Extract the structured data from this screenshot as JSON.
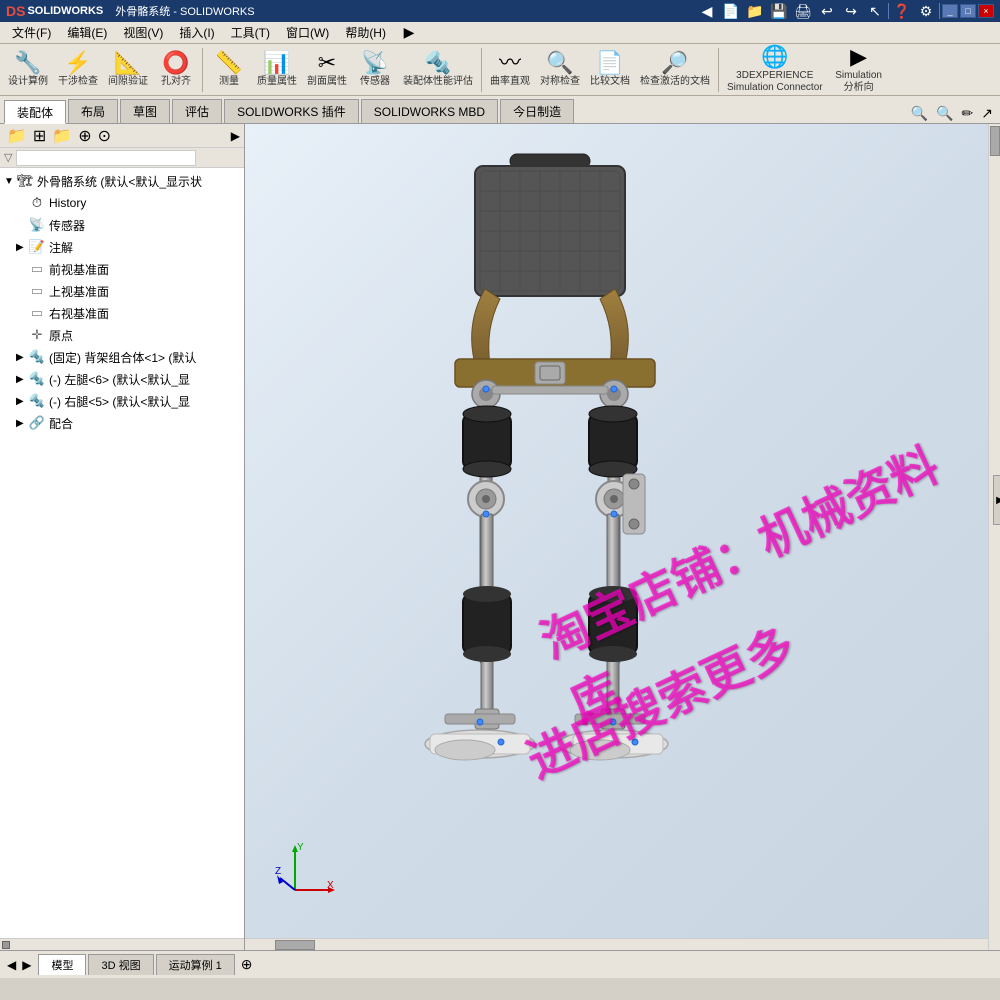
{
  "app": {
    "name": "SOLIDWORKS",
    "logo": "DS",
    "title": "外骨骼系统 - SOLIDWORKS"
  },
  "menubar": {
    "items": [
      "文件(F)",
      "编辑(E)",
      "视图(V)",
      "插入(I)",
      "工具(T)",
      "窗口(W)",
      "帮助(H)"
    ]
  },
  "toolbar": {
    "groups": [
      {
        "icon": "🔧",
        "label": "设计算例"
      },
      {
        "icon": "⚡",
        "label": "干涉检查"
      },
      {
        "icon": "📐",
        "label": "间隙验证"
      },
      {
        "icon": "⭕",
        "label": "孔对齐"
      },
      {
        "icon": "📏",
        "label": "测量"
      },
      {
        "icon": "📊",
        "label": "质量属性"
      },
      {
        "icon": "✂",
        "label": "剖面属性"
      },
      {
        "icon": "📡",
        "label": "传感器"
      },
      {
        "icon": "🔩",
        "label": "装配体性能评估"
      },
      {
        "icon": "〰",
        "label": "曲率直观"
      },
      {
        "icon": "🔍",
        "label": "对称检查"
      },
      {
        "icon": "📄",
        "label": "比较文档"
      },
      {
        "icon": "🔎",
        "label": "检查激活的文档"
      }
    ],
    "right_groups": [
      {
        "icon": "🌐",
        "label": "3DEXPERIENCE\nSimulation Connector"
      },
      {
        "icon": "▶",
        "label": "Simulation\n分析向"
      }
    ]
  },
  "tabs": {
    "items": [
      "装配体",
      "布局",
      "草图",
      "评估",
      "SOLIDWORKS 插件",
      "SOLIDWORKS MBD",
      "今日制造"
    ],
    "active": 0
  },
  "subtoolbar": {
    "icons": [
      "🔍",
      "🔍",
      "✏",
      "↗"
    ]
  },
  "feature_tree": {
    "root_label": "外骨骼系统 (默认<默认_显示状",
    "items": [
      {
        "level": 1,
        "icon": "⏱",
        "label": "History",
        "has_arrow": false
      },
      {
        "level": 1,
        "icon": "📡",
        "label": "传感器",
        "has_arrow": false
      },
      {
        "level": 1,
        "icon": "📝",
        "label": "注解",
        "has_arrow": true
      },
      {
        "level": 1,
        "icon": "⬜",
        "label": "前视基准面",
        "has_arrow": false
      },
      {
        "level": 1,
        "icon": "⬜",
        "label": "上视基准面",
        "has_arrow": false
      },
      {
        "level": 1,
        "icon": "⬜",
        "label": "右视基准面",
        "has_arrow": false
      },
      {
        "level": 1,
        "icon": "✛",
        "label": "原点",
        "has_arrow": false
      },
      {
        "level": 1,
        "icon": "🔩",
        "label": "(固定) 背架组合体<1> (默认",
        "has_arrow": true
      },
      {
        "level": 1,
        "icon": "🔩",
        "label": "(-) 左腿<6> (默认<默认_显",
        "has_arrow": true
      },
      {
        "level": 1,
        "icon": "🔩",
        "label": "(-) 右腿<5> (默认<默认_显",
        "has_arrow": true
      },
      {
        "level": 1,
        "icon": "🔗",
        "label": "配合",
        "has_arrow": true
      }
    ]
  },
  "viewport": {
    "watermarks": [
      "淘宝店铺：机械资料库",
      "进店搜索更多"
    ]
  },
  "statusbar": {
    "tabs": [
      "模型",
      "3D 视图",
      "运动算例 1"
    ]
  }
}
